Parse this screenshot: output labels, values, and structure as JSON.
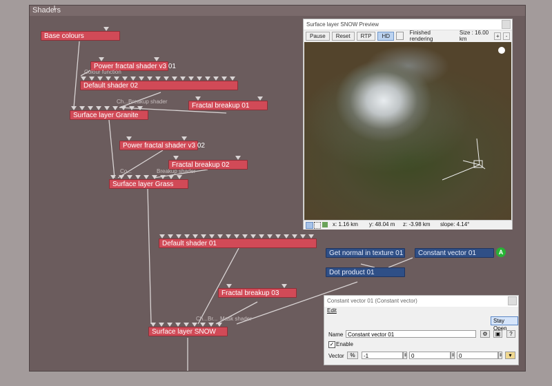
{
  "panel_title": "Shaders",
  "nodes": {
    "base_colours": "Base colours",
    "power_fractal_01": "Power fractal shader v3 01",
    "default_shader_02": "Default shader 02",
    "fractal_breakup_01": "Fractal breakup 01",
    "surface_layer_granite": "Surface layer Granite",
    "power_fractal_02": "Power fractal shader v3 02",
    "fractal_breakup_02": "Fractal breakup 02",
    "surface_layer_grass": "Surface layer Grass",
    "default_shader_01": "Default shader 01",
    "fractal_breakup_03": "Fractal breakup 03",
    "surface_layer_snow": "Surface layer SNOW",
    "get_normal": "Get normal in texture 01",
    "constant_vector": "Constant vector 01",
    "dot_product": "Dot product 01"
  },
  "port_labels": {
    "colour_function": "Colour function",
    "ch_granite": "Ch...",
    "breakup_granite": "Breakup shader",
    "co_grass": "Co...",
    "breakup_grass": "Breakup shader",
    "ch_snow": "Ch...",
    "br_snow": "Br...",
    "mask_shader": "Mask shader"
  },
  "badge": "A",
  "preview": {
    "title": "Surface layer SNOW Preview",
    "pause": "Pause",
    "reset": "Reset",
    "rtp": "RTP",
    "hd": "HD",
    "status": "Finished rendering",
    "size": "Size : 16.00 km",
    "x": "x: 1.16 km",
    "y": "y: 48.04 m",
    "z": "z: -3.98 km",
    "slope": "slope: 4.14°"
  },
  "dialog": {
    "title": "Constant vector 01   (Constant vector)",
    "menu_edit": "Edit",
    "stay_open": "Stay Open",
    "name_label": "Name",
    "name_value": "Constant vector 01",
    "enable_label": "Enable",
    "vector_label": "Vector",
    "v1": "-1",
    "v2": "0",
    "v3": "0"
  },
  "colors": {
    "node_red": "#d14a57",
    "node_blue": "#2f4f86",
    "graph_bg": "#6b5c5d",
    "badge_green": "#27b335"
  }
}
